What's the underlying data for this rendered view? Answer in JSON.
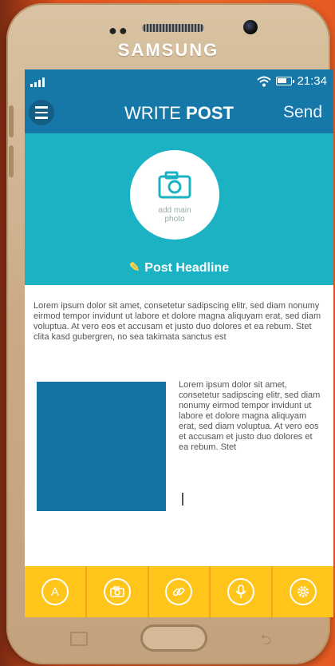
{
  "device": {
    "brand": "SAMSUNG"
  },
  "status_bar": {
    "time": "21:34"
  },
  "app_bar": {
    "title_light": "WRITE",
    "title_bold": "POST",
    "send_label": "Send"
  },
  "hero": {
    "photo_label_line1": "add main",
    "photo_label_line2": "photo",
    "headline": "Post Headline"
  },
  "body": {
    "paragraph": "Lorem ipsum dolor sit amet, consetetur sadipscing elitr, sed diam nonumy eirmod tempor invidunt ut labore et dolore magna aliquyam erat, sed diam voluptua. At vero eos et accusam et justo duo dolores et ea rebum. Stet clita kasd gubergren, no sea takimata sanctus est",
    "side_text": "Lorem ipsum dolor sit amet, consetetur sadipscing elitr, sed diam nonumy eirmod tempor invidunt ut labore et dolore magna aliquyam erat, sed diam voluptua. At vero eos et accusam et justo duo dolores et ea rebum. Stet"
  },
  "toolbar": {
    "items": [
      {
        "icon": "text-format-icon",
        "glyph": "A"
      },
      {
        "icon": "camera-icon",
        "glyph": ""
      },
      {
        "icon": "link-icon",
        "glyph": ""
      },
      {
        "icon": "microphone-icon",
        "glyph": ""
      },
      {
        "icon": "settings-icon",
        "glyph": ""
      }
    ]
  },
  "colors": {
    "primary": "#1578a8",
    "hero": "#1bb3c4",
    "toolbar": "#ffc51a",
    "accent": "#ffd24a"
  }
}
